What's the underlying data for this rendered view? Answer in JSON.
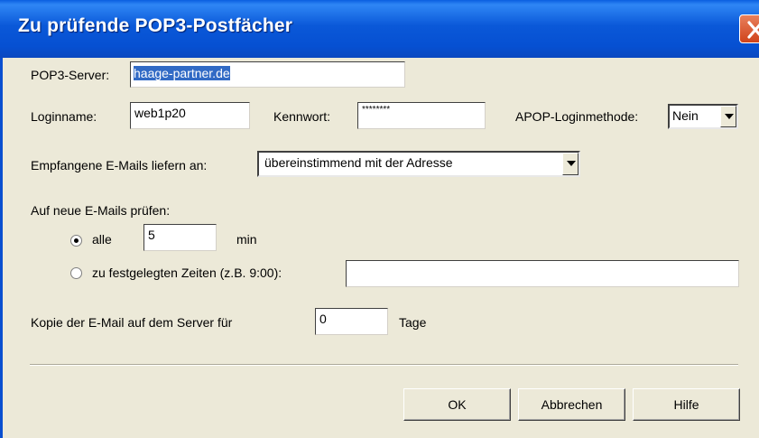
{
  "window": {
    "title": "Zu prüfende POP3-Postfächer"
  },
  "pop3": {
    "label": "POP3-Server:",
    "value": "haage-partner.de"
  },
  "login": {
    "label": "Loginname:",
    "value": "web1p20"
  },
  "password": {
    "label": "Kennwort:",
    "value": "********"
  },
  "apop": {
    "label": "APOP-Loginmethode:",
    "value": "Nein"
  },
  "deliver": {
    "label": "Empfangene E-Mails liefern an:",
    "value": "übereinstimmend mit der Adresse"
  },
  "check": {
    "label": "Auf neue E-Mails prüfen:",
    "every_label": "alle",
    "every_value": "5",
    "every_unit": "min",
    "every_selected": true,
    "fixed_label": "zu festgelegten Zeiten (z.B. 9:00):",
    "fixed_value": ""
  },
  "copy": {
    "label": "Kopie der E-Mail auf dem Server für",
    "value": "0",
    "unit": "Tage"
  },
  "buttons": {
    "ok": "OK",
    "cancel": "Abbrechen",
    "help": "Hilfe"
  }
}
